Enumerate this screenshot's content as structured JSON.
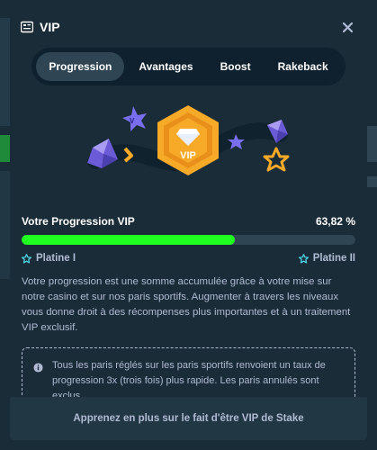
{
  "modal": {
    "title": "VIP",
    "close_icon": "close-icon",
    "title_icon": "vip-card-icon"
  },
  "tabs": [
    {
      "label": "Progression",
      "active": true
    },
    {
      "label": "Avantages",
      "active": false
    },
    {
      "label": "Boost",
      "active": false
    },
    {
      "label": "Rakeback",
      "active": false
    }
  ],
  "hero": {
    "badge_text": "VIP"
  },
  "progress": {
    "title": "Votre Progression VIP",
    "percent_text": "63,82 %",
    "fraction": 0.6382,
    "current_level": "Platine I",
    "next_level": "Platine II"
  },
  "description": "Votre progression est une somme accumulée grâce à votre mise sur notre casino et sur nos paris sportifs. Augmenter à travers les niveaux vous donne droit à des récompenses plus importantes et à un traitement VIP exclusif.",
  "info": {
    "text": "Tous les paris réglés sur les paris sportifs renvoient un taux de progression 3x (trois fois) plus rapide. Les paris annulés sont exclus."
  },
  "footer": {
    "link_text": "Apprenez en plus sur le fait d'être VIP de Stake"
  },
  "colors": {
    "bg": "#1a2c38",
    "progress": "#1fff20",
    "track": "#2f4553",
    "badge": "#f7a928"
  }
}
